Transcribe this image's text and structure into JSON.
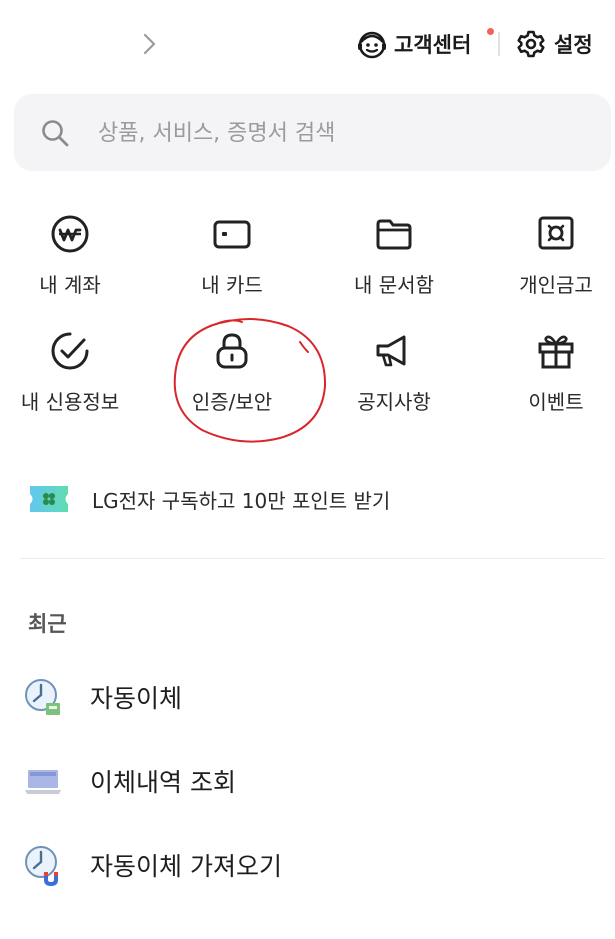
{
  "header": {
    "customer_center_label": "고객센터",
    "settings_label": "설정"
  },
  "search": {
    "placeholder": "상품, 서비스, 증명서 검색"
  },
  "menu": {
    "items": [
      {
        "label": "내 계좌",
        "icon": "won-circle-icon"
      },
      {
        "label": "내 카드",
        "icon": "card-icon"
      },
      {
        "label": "내 문서함",
        "icon": "folder-icon"
      },
      {
        "label": "개인금고",
        "icon": "safe-icon"
      },
      {
        "label": "내 신용정보",
        "icon": "check-circle-icon"
      },
      {
        "label": "인증/보안",
        "icon": "lock-icon"
      },
      {
        "label": "공지사항",
        "icon": "megaphone-icon"
      },
      {
        "label": "이벤트",
        "icon": "gift-icon"
      }
    ]
  },
  "promo": {
    "text": "LG전자 구독하고 10만 포인트 받기",
    "icon": "ticket-clover-icon"
  },
  "recent": {
    "title": "최근",
    "items": [
      {
        "label": "자동이체",
        "icon": "clock-transfer-icon"
      },
      {
        "label": "이체내역 조회",
        "icon": "laptop-icon"
      },
      {
        "label": "자동이체 가져오기",
        "icon": "clock-magnet-icon"
      }
    ]
  },
  "colors": {
    "accent_dot": "#f0625a",
    "annotation_circle": "#d8262a",
    "search_bg": "#f4f4f6",
    "icon_stroke": "#222222"
  }
}
